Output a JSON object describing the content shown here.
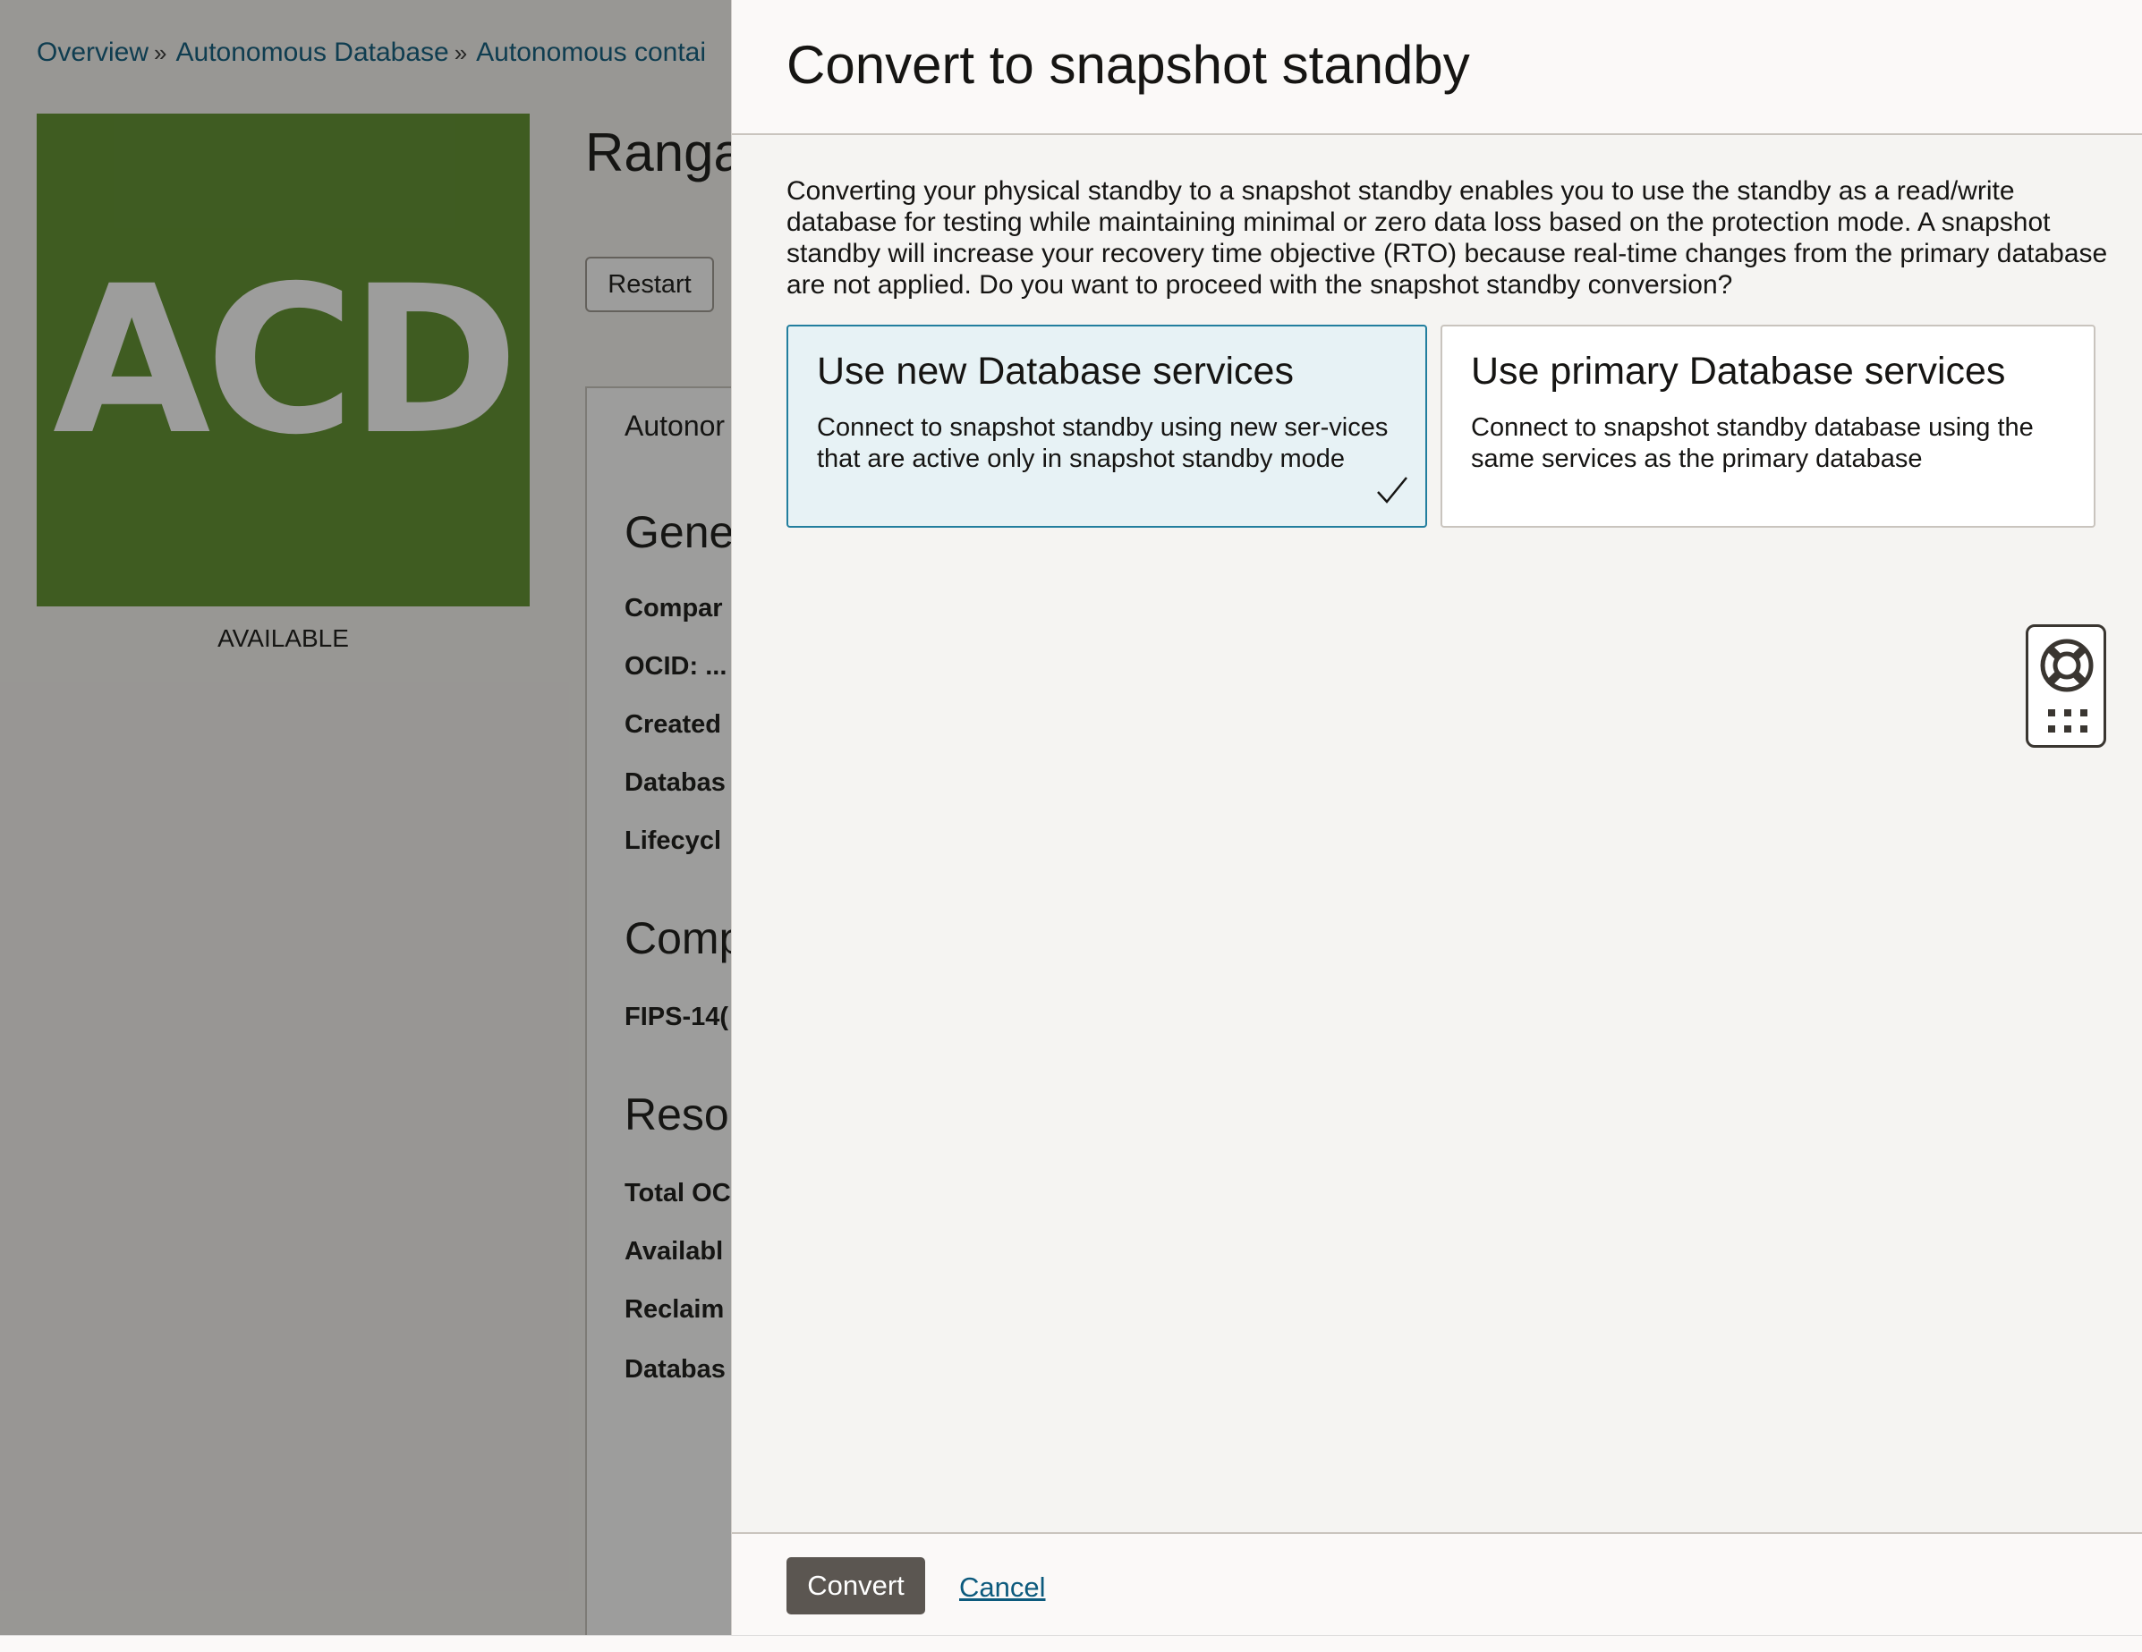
{
  "breadcrumb": {
    "items": [
      "Overview",
      "Autonomous Database",
      "Autonomous contai"
    ],
    "separator": "»"
  },
  "resource": {
    "tile_text": "ACD",
    "tile_color": "#5d8f2c",
    "status": "AVAILABLE",
    "title": "Ranga",
    "restart_label": "Restart"
  },
  "info_panel": {
    "tab_label": "Autonor",
    "sections": {
      "general": "Gene",
      "compliance": "Comp",
      "resources": "Reso"
    },
    "fields": {
      "compartment": "Compar",
      "ocid": "OCID: ...",
      "created": "Created",
      "database": "Databas",
      "lifecycle": "Lifecycl",
      "fips": "FIPS-14(",
      "total": "Total OC",
      "available": "Availabl",
      "reclaimable": "Reclaim",
      "database2": "Databas"
    }
  },
  "drawer": {
    "title": "Convert to snapshot standby",
    "description": "Converting your physical standby to a snapshot standby enables you to use the standby as a read/write database for testing while maintaining minimal or zero data loss based on the protection mode. A snapshot standby will increase your recovery time objective (RTO) because real-time changes from the primary database are not applied. Do you want to proceed with the snapshot standby conversion?",
    "options": [
      {
        "title": "Use new Database services",
        "description": "Connect to snapshot standby using new ser-vices that are active only in snapshot standby mode",
        "selected": true
      },
      {
        "title": "Use primary Database services",
        "description": "Connect to snapshot standby database using the same services as the primary database",
        "selected": false
      }
    ],
    "convert_label": "Convert",
    "cancel_label": "Cancel"
  },
  "colors": {
    "accent": "#227e9e",
    "link": "#0c5a7d",
    "primary_button": "#5b5651",
    "selected_card_bg": "#e7f2f5"
  },
  "icons": {
    "breadcrumb_separator": "double-chevron-right-icon",
    "selected_option": "checkmark-icon",
    "help": "lifebuoy-icon",
    "help_menu": "grid-dots-icon"
  }
}
